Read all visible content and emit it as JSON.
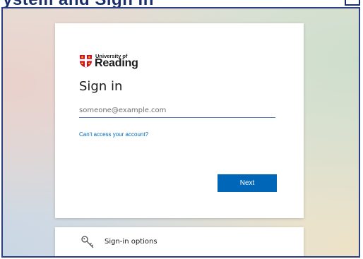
{
  "page_heading_fragment": "ystem and Sign in",
  "login": {
    "logo": {
      "line1": "University of",
      "line2": "Reading"
    },
    "title": "Sign in",
    "email_placeholder": "someone@example.com",
    "email_value": "",
    "cant_access_link": "Can't access your account?",
    "next_button": "Next"
  },
  "signin_options": {
    "icon": "key-icon",
    "label": "Sign-in options"
  },
  "colors": {
    "accent": "#0067b8",
    "frame_border": "#2b3f82",
    "logo_shield_red": "#c8102e",
    "text": "#1b1b1b"
  }
}
